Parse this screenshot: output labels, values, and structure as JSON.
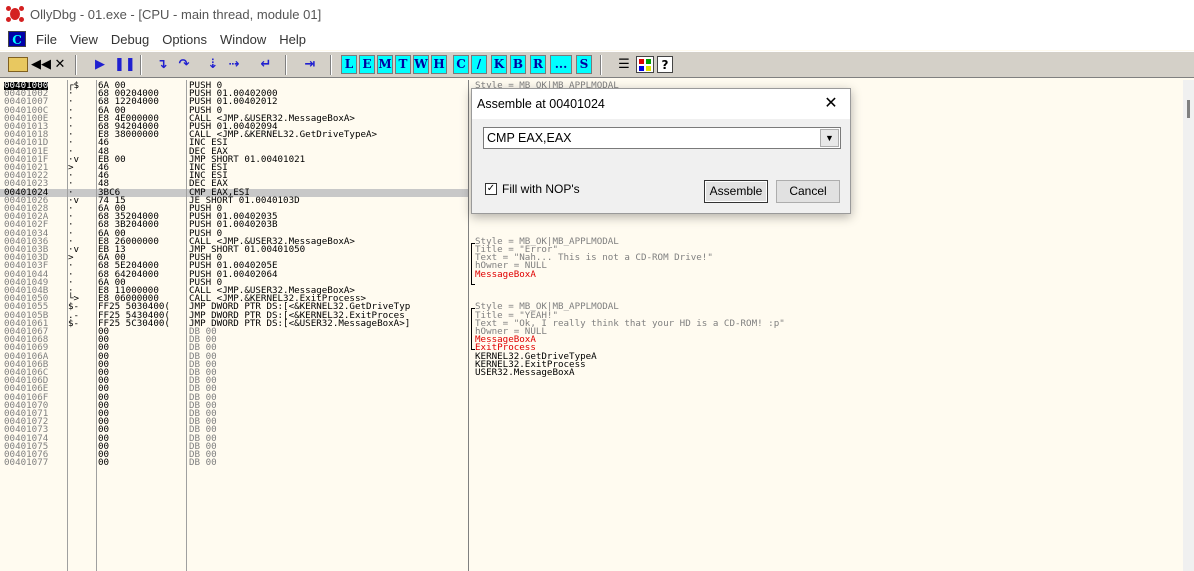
{
  "window": {
    "title": "OllyDbg - 01.exe - [CPU - main thread, module 01]"
  },
  "menu": {
    "c_label": "C",
    "items": [
      "File",
      "View",
      "Debug",
      "Options",
      "Window",
      "Help"
    ]
  },
  "toolbar": {
    "letters": [
      "L",
      "E",
      "M",
      "T",
      "W",
      "H",
      "C",
      "/",
      "K",
      "B",
      "R",
      "...",
      "S"
    ],
    "help_label": "?"
  },
  "disasm": [
    {
      "addr": "00401000",
      "flow": "┌$",
      "hex": "6A 00",
      "dis": "PUSH 0"
    },
    {
      "addr": "00401002",
      "flow": "·",
      "hex": "68 00204000",
      "dis": "PUSH 01.00402000"
    },
    {
      "addr": "00401007",
      "flow": "·",
      "hex": "68 12204000",
      "dis": "PUSH 01.00402012"
    },
    {
      "addr": "0040100C",
      "flow": "·",
      "hex": "6A 00",
      "dis": "PUSH 0"
    },
    {
      "addr": "0040100E",
      "flow": "·",
      "hex": "E8 4E000000",
      "dis": "CALL <JMP.&USER32.MessageBoxA>"
    },
    {
      "addr": "00401013",
      "flow": "·",
      "hex": "68 94204000",
      "dis": "PUSH 01.00402094"
    },
    {
      "addr": "00401018",
      "flow": "·",
      "hex": "E8 38000000",
      "dis": "CALL <JMP.&KERNEL32.GetDriveTypeA>"
    },
    {
      "addr": "0040101D",
      "flow": "·",
      "hex": "46",
      "dis": "INC ESI"
    },
    {
      "addr": "0040101E",
      "flow": "·",
      "hex": "48",
      "dis": "DEC EAX"
    },
    {
      "addr": "0040101F",
      "flow": "·v",
      "hex": "EB 00",
      "dis": "JMP SHORT 01.00401021"
    },
    {
      "addr": "00401021",
      "flow": ">",
      "hex": "46",
      "dis": "INC ESI"
    },
    {
      "addr": "00401022",
      "flow": "·",
      "hex": "46",
      "dis": "INC ESI"
    },
    {
      "addr": "00401023",
      "flow": "·",
      "hex": "48",
      "dis": "DEC EAX"
    },
    {
      "addr": "00401024",
      "flow": "·",
      "hex": "3BC6",
      "dis": "CMP EAX,ESI"
    },
    {
      "addr": "00401026",
      "flow": "·v",
      "hex": "74 15",
      "dis": "JE SHORT 01.0040103D"
    },
    {
      "addr": "00401028",
      "flow": "·",
      "hex": "6A 00",
      "dis": "PUSH 0"
    },
    {
      "addr": "0040102A",
      "flow": "·",
      "hex": "68 35204000",
      "dis": "PUSH 01.00402035"
    },
    {
      "addr": "0040102F",
      "flow": "·",
      "hex": "68 3B204000",
      "dis": "PUSH 01.0040203B"
    },
    {
      "addr": "00401034",
      "flow": "·",
      "hex": "6A 00",
      "dis": "PUSH 0"
    },
    {
      "addr": "00401036",
      "flow": "·",
      "hex": "E8 26000000",
      "dis": "CALL <JMP.&USER32.MessageBoxA>"
    },
    {
      "addr": "0040103B",
      "flow": "·v",
      "hex": "EB 13",
      "dis": "JMP SHORT 01.00401050"
    },
    {
      "addr": "0040103D",
      "flow": ">",
      "hex": "6A 00",
      "dis": "PUSH 0"
    },
    {
      "addr": "0040103F",
      "flow": "·",
      "hex": "68 5E204000",
      "dis": "PUSH 01.0040205E"
    },
    {
      "addr": "00401044",
      "flow": "·",
      "hex": "68 64204000",
      "dis": "PUSH 01.00402064"
    },
    {
      "addr": "00401049",
      "flow": "·",
      "hex": "6A 00",
      "dis": "PUSH 0"
    },
    {
      "addr": "0040104B",
      "flow": "·",
      "hex": "E8 11000000",
      "dis": "CALL <JMP.&USER32.MessageBoxA>"
    },
    {
      "addr": "00401050",
      "flow": "└>",
      "hex": "E8 06000000",
      "dis": "CALL <JMP.&KERNEL32.ExitProcess>"
    },
    {
      "addr": "00401055",
      "flow": "$-",
      "hex": "FF25 5030400(",
      "dis": "JMP DWORD PTR DS:[<&KERNEL32.GetDriveTyp"
    },
    {
      "addr": "0040105B",
      "flow": ".-",
      "hex": "FF25 5430400(",
      "dis": "JMP DWORD PTR DS:[<&KERNEL32.ExitProces"
    },
    {
      "addr": "00401061",
      "flow": "$-",
      "hex": "FF25 5C30400(",
      "dis": "JMP DWORD PTR DS:[<&USER32.MessageBoxA>]"
    },
    {
      "addr": "00401067",
      "flow": "",
      "hex": "00",
      "dis": "DB 00"
    },
    {
      "addr": "00401068",
      "flow": "",
      "hex": "00",
      "dis": "DB 00"
    },
    {
      "addr": "00401069",
      "flow": "",
      "hex": "00",
      "dis": "DB 00"
    },
    {
      "addr": "0040106A",
      "flow": "",
      "hex": "00",
      "dis": "DB 00"
    },
    {
      "addr": "0040106B",
      "flow": "",
      "hex": "00",
      "dis": "DB 00"
    },
    {
      "addr": "0040106C",
      "flow": "",
      "hex": "00",
      "dis": "DB 00"
    },
    {
      "addr": "0040106D",
      "flow": "",
      "hex": "00",
      "dis": "DB 00"
    },
    {
      "addr": "0040106E",
      "flow": "",
      "hex": "00",
      "dis": "DB 00"
    },
    {
      "addr": "0040106F",
      "flow": "",
      "hex": "00",
      "dis": "DB 00"
    },
    {
      "addr": "00401070",
      "flow": "",
      "hex": "00",
      "dis": "DB 00"
    },
    {
      "addr": "00401071",
      "flow": "",
      "hex": "00",
      "dis": "DB 00"
    },
    {
      "addr": "00401072",
      "flow": "",
      "hex": "00",
      "dis": "DB 00"
    },
    {
      "addr": "00401073",
      "flow": "",
      "hex": "00",
      "dis": "DB 00"
    },
    {
      "addr": "00401074",
      "flow": "",
      "hex": "00",
      "dis": "DB 00"
    },
    {
      "addr": "00401075",
      "flow": "",
      "hex": "00",
      "dis": "DB 00"
    },
    {
      "addr": "00401076",
      "flow": "",
      "hex": "00",
      "dis": "DB 00"
    },
    {
      "addr": "00401077",
      "flow": "",
      "hex": "00",
      "dis": "DB 00"
    }
  ],
  "comments": [
    {
      "row": 0,
      "text": "Style = MB_OK|MB_APPLMODAL",
      "color": "gray"
    },
    {
      "row": 19,
      "text": "Style = MB_OK|MB_APPLMODAL",
      "color": "gray"
    },
    {
      "row": 20,
      "text": "Title = \"Error\"",
      "color": "gray"
    },
    {
      "row": 21,
      "text": "Text = \"Nah... This is not a CD-ROM Drive!\"",
      "color": "gray"
    },
    {
      "row": 22,
      "text": "hOwner = NULL",
      "color": "gray"
    },
    {
      "row": 23,
      "text": "MessageBoxA",
      "color": "red"
    },
    {
      "row": 27,
      "text": "Style = MB_OK|MB_APPLMODAL",
      "color": "gray"
    },
    {
      "row": 28,
      "text": "Title = \"YEAH!\"",
      "color": "gray"
    },
    {
      "row": 29,
      "text": "Text = \"Ok, I really think that your HD is a CD-ROM! :p\"",
      "color": "gray"
    },
    {
      "row": 30,
      "text": "hOwner = NULL",
      "color": "gray"
    },
    {
      "row": 31,
      "text": "MessageBoxA",
      "color": "red"
    },
    {
      "row": 32,
      "text": "ExitProcess",
      "color": "red"
    },
    {
      "row": 33,
      "text": "KERNEL32.GetDriveTypeA",
      "color": "black"
    },
    {
      "row": 34,
      "text": "KERNEL32.ExitProcess",
      "color": "black"
    },
    {
      "row": 35,
      "text": "USER32.MessageBoxA",
      "color": "black"
    }
  ],
  "dialog": {
    "title": "Assemble at 00401024",
    "input_value": "CMP EAX,EAX",
    "checkbox_label": "Fill with NOP's",
    "checkbox_checked": "✓",
    "assemble_label": "Assemble",
    "cancel_label": "Cancel",
    "close_glyph": "✕"
  },
  "colors": {
    "background": "#fffbf0",
    "toolbar": "#d4d0c8",
    "letter_button": "#00ffff",
    "comment_red": "#e00000"
  }
}
